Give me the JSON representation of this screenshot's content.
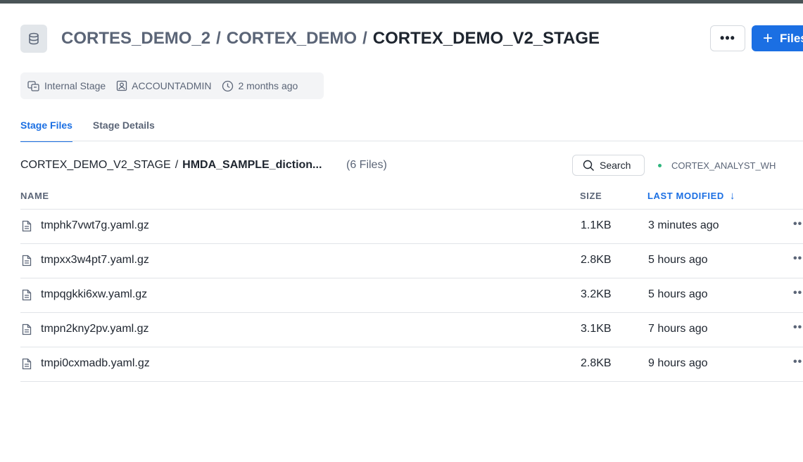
{
  "header": {
    "breadcrumb": [
      "CORTES_DEMO_2",
      "CORTEX_DEMO",
      "CORTEX_DEMO_V2_STAGE"
    ],
    "separator": "/",
    "more_label": "•••",
    "new_file_plus": "+",
    "new_file_label": "Files",
    "icon": "database-icon"
  },
  "meta": {
    "stage_type": "Internal Stage",
    "owner": "ACCOUNTADMIN",
    "created": "2 months ago"
  },
  "tabs": [
    {
      "label": "Stage Files",
      "active": true
    },
    {
      "label": "Stage Details",
      "active": false
    }
  ],
  "path": {
    "root": "CORTEX_DEMO_V2_STAGE",
    "slash": "/",
    "current": "HMDA_SAMPLE_diction...",
    "file_count": "(6 Files)"
  },
  "search": {
    "label": "Search"
  },
  "warehouse": {
    "name": "CORTEX_ANALYST_WH",
    "status_color": "#2eb67d"
  },
  "table": {
    "columns": {
      "name": "NAME",
      "size": "SIZE",
      "last_modified": "LAST MODIFIED"
    },
    "sort_arrow": "↓",
    "rows": [
      {
        "name": "tmphk7vwt7g.yaml.gz",
        "size": "1.1KB",
        "modified": "3 minutes ago"
      },
      {
        "name": "tmpxx3w4pt7.yaml.gz",
        "size": "2.8KB",
        "modified": "5 hours ago"
      },
      {
        "name": "tmpqgkki6xw.yaml.gz",
        "size": "3.2KB",
        "modified": "5 hours ago"
      },
      {
        "name": "tmpn2kny2pv.yaml.gz",
        "size": "3.1KB",
        "modified": "7 hours ago"
      },
      {
        "name": "tmpi0cxmadb.yaml.gz",
        "size": "2.8KB",
        "modified": "9 hours ago"
      }
    ],
    "row_more_label": "••"
  },
  "colors": {
    "accent": "#1b6fe3",
    "muted": "#5b6577"
  }
}
